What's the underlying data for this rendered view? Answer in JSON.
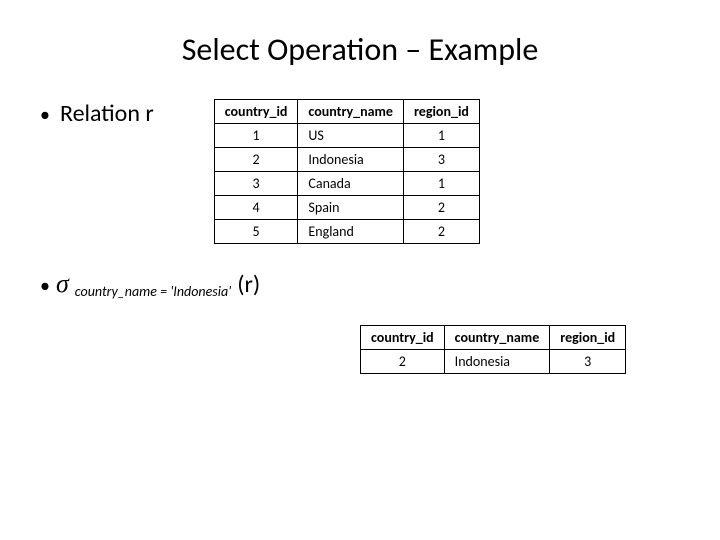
{
  "title": "Select Operation – Example",
  "bullets": {
    "relation": "Relation r",
    "sigma_sub": "country_name = ",
    "sigma_val": "'Indonesia'",
    "sigma_arg": "(r)"
  },
  "table1": {
    "headers": [
      "country_id",
      "country_name",
      "region_id"
    ],
    "rows": [
      {
        "id": "1",
        "name": "US",
        "region": "1"
      },
      {
        "id": "2",
        "name": "Indonesia",
        "region": "3"
      },
      {
        "id": "3",
        "name": "Canada",
        "region": "1"
      },
      {
        "id": "4",
        "name": "Spain",
        "region": "2"
      },
      {
        "id": "5",
        "name": "England",
        "region": "2"
      }
    ]
  },
  "table2": {
    "headers": [
      "country_id",
      "country_name",
      "region_id"
    ],
    "rows": [
      {
        "id": "2",
        "name": "Indonesia",
        "region": "3"
      }
    ]
  }
}
